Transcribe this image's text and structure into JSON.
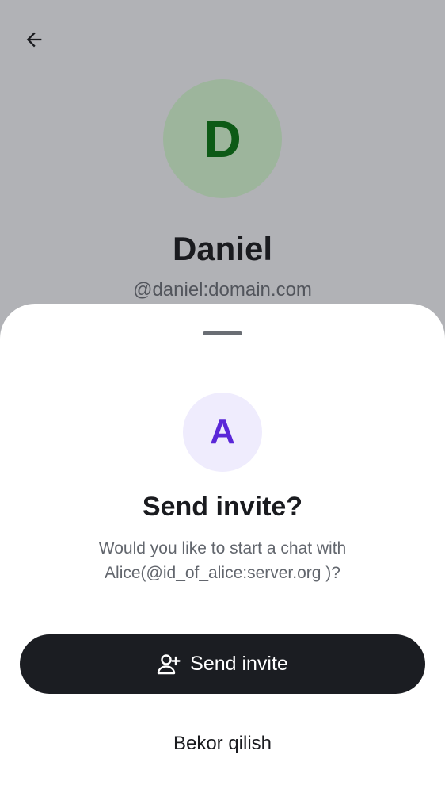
{
  "profile": {
    "avatar_initial": "D",
    "name": "Daniel",
    "user_id": "@daniel:domain.com"
  },
  "sheet": {
    "avatar_initial": "A",
    "title": "Send invite?",
    "description": "Would you like to start a chat with Alice(@id_of_alice:server.org )?",
    "primary_button": {
      "label": "Send invite",
      "icon": "person-add-icon"
    },
    "secondary_button": {
      "label": "Bekor qilish"
    }
  },
  "icons": {
    "back": "arrow-left-icon"
  },
  "colors": {
    "scrim": "#b1b2b6",
    "profile_avatar_bg": "#9db59c",
    "profile_avatar_fg": "#0d5a16",
    "invitee_avatar_bg": "#efecfd",
    "invitee_avatar_fg": "#5a27d8",
    "primary_button_bg": "#1b1d22"
  }
}
